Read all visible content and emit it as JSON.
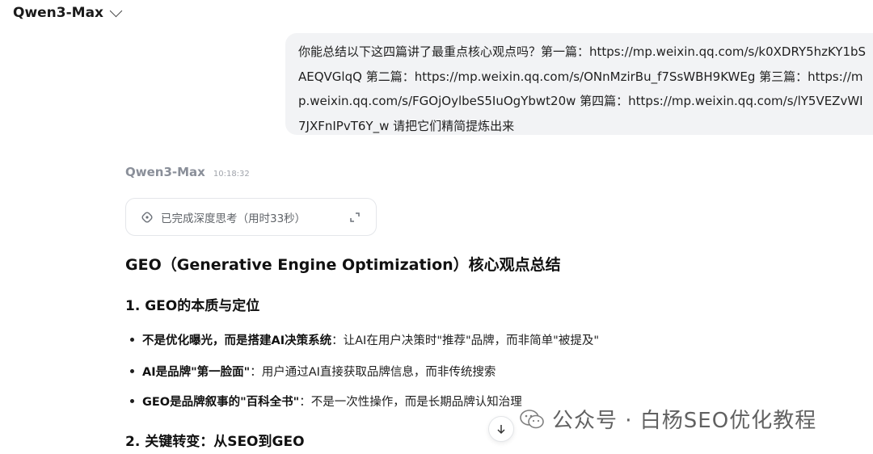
{
  "header": {
    "model_name": "Qwen3-Max",
    "dropdown_icon": "chevron-down-icon"
  },
  "user_message": {
    "text": "你能总结以下这四篇讲了最重点核心观点吗？第一篇：https://mp.weixin.qq.com/s/k0XDRY5hzKY1bSAEQVGlqQ  第二篇：https://mp.weixin.qq.com/s/ONnMzirBu_f7SsWBH9KWEg  第三篇：https://mp.weixin.qq.com/s/FGOjOylbeS5IuOgYbwt20w  第四篇：https://mp.weixin.qq.com/s/lY5VEZvWI7JXFnIPvT6Y_w  请把它们精简提炼出来"
  },
  "assistant": {
    "name": "Qwen3-Max",
    "time": "10:18:32",
    "thinking": {
      "label": "已完成深度思考（用时33秒）",
      "icon": "thinking-icon",
      "expand_icon": "expand-icon"
    },
    "title": "GEO（Generative Engine Optimization）核心观点总结",
    "section1": {
      "heading": "1. GEO的本质与定位",
      "bullets": [
        {
          "bold": "不是优化曝光，而是搭建AI决策系统",
          "text": "：让AI在用户决策时\"推荐\"品牌，而非简单\"被提及\""
        },
        {
          "bold": "AI是品牌\"第一脸面\"",
          "text": "：用户通过AI直接获取品牌信息，而非传统搜索"
        },
        {
          "bold": "GEO是品牌叙事的\"百科全书\"",
          "text": "：不是一次性操作，而是长期品牌认知治理"
        }
      ]
    },
    "section2": {
      "heading": "2. 关键转变：从SEO到GEO"
    }
  },
  "scroll_button_icon": "arrow-down-icon",
  "watermark": {
    "text": "公众号 · 白杨SEO优化教程",
    "icon": "wechat-icon"
  }
}
